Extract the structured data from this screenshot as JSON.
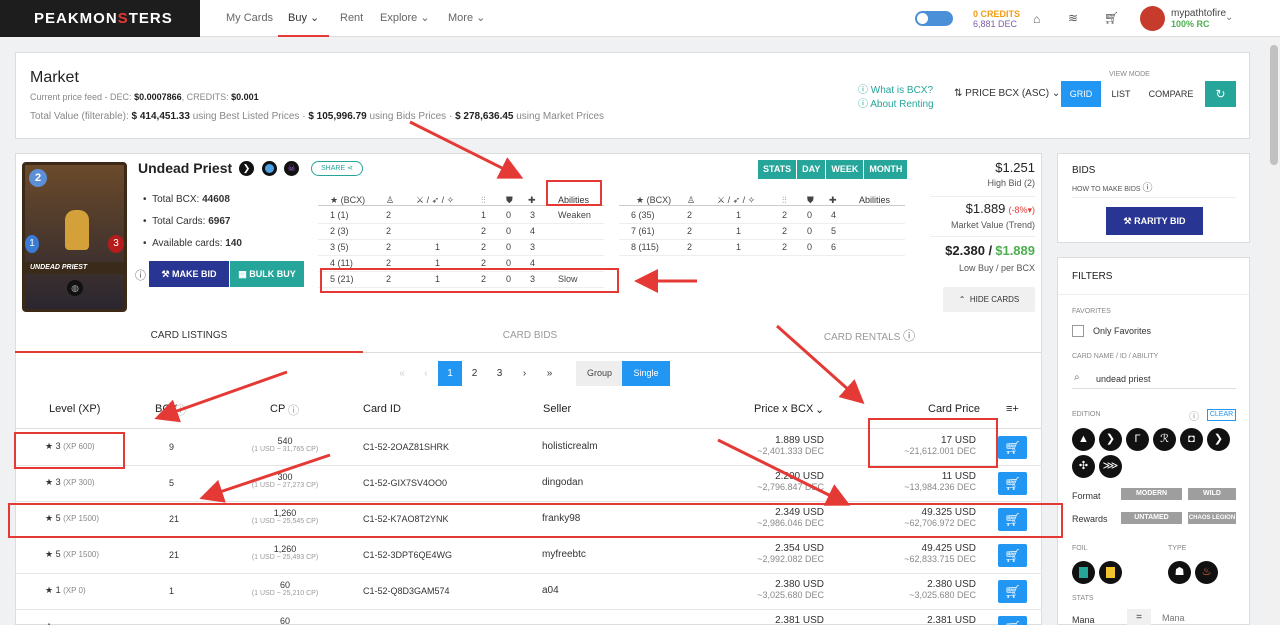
{
  "nav": {
    "logo_a": "PEAKMON",
    "logo_s": "S",
    "logo_b": "TERS",
    "links": [
      "My Cards",
      "Buy",
      "Rent",
      "Explore",
      "More"
    ],
    "credits": "0 CREDITS",
    "dec": "6,881 DEC",
    "username": "mypathtofire",
    "rc": "100% RC"
  },
  "market": {
    "title": "Market",
    "price_feed_label": "Current price feed - DEC:",
    "dec_price": "$0.0007866",
    "credits_label": ", CREDITS:",
    "credits_price": "$0.001",
    "total_label": "Total Value (filterable):",
    "best_value": "$ 414,451.33",
    "best_label": "using Best Listed Prices",
    "bids_value": "$ 105,996.79",
    "bids_label": "using Bids Prices",
    "market_value": "$ 278,636.45",
    "market_label": "using Market Prices",
    "what_bcx": "What is BCX?",
    "about_renting": "About Renting",
    "sort": "PRICE BCX (ASC)",
    "view_mode": "VIEW MODE",
    "view_buttons": [
      "GRID",
      "LIST",
      "COMPARE"
    ]
  },
  "card": {
    "name": "Undead Priest",
    "share": "SHARE",
    "image_label": "UNDEAD PRIEST",
    "mana": "2",
    "stat_left": "1",
    "stat_right": "3",
    "total_bcx_label": "Total BCX:",
    "total_bcx": "44608",
    "total_cards_label": "Total Cards:",
    "total_cards": "6967",
    "available_label": "Available cards:",
    "available": "140",
    "make_bid": "MAKE BID",
    "bulk_buy": "BULK BUY",
    "period_buttons": [
      "STATS",
      "DAY",
      "WEEK",
      "MONTH"
    ],
    "high_bid_price": "$1.251",
    "high_bid_label": "High Bid (2)",
    "market_value_price": "$1.889",
    "market_change": "(-8%",
    "market_value_label": "Market Value (Trend)",
    "low_buy": "$2.380 /",
    "per_bcx": "$1.889",
    "low_buy_label": "Low Buy / per BCX",
    "hide_cards": "HIDE CARDS"
  },
  "stats_table": {
    "headers": [
      "★ (BCX)",
      "♙",
      "⚔ / ➶ / ✧",
      "⫶⫶",
      "⛊",
      "✚",
      "Abilities"
    ],
    "left_rows": [
      [
        "1 (1)",
        "2",
        "",
        "1",
        "0",
        "3",
        "Weaken"
      ],
      [
        "2 (3)",
        "2",
        "",
        "2",
        "0",
        "4",
        ""
      ],
      [
        "3 (5)",
        "2",
        "1",
        "2",
        "0",
        "3",
        ""
      ],
      [
        "4 (11)",
        "2",
        "1",
        "2",
        "0",
        "4",
        ""
      ],
      [
        "5 (21)",
        "2",
        "1",
        "2",
        "0",
        "3",
        "Slow"
      ]
    ],
    "right_rows": [
      [
        "6 (35)",
        "2",
        "1",
        "2",
        "0",
        "4",
        ""
      ],
      [
        "7 (61)",
        "2",
        "1",
        "2",
        "0",
        "5",
        ""
      ],
      [
        "8 (115)",
        "2",
        "1",
        "2",
        "0",
        "6",
        ""
      ]
    ]
  },
  "tabs": [
    "CARD LISTINGS",
    "CARD BIDS",
    "CARD RENTALS"
  ],
  "pagination": {
    "pages": [
      "«",
      "‹",
      "1",
      "2",
      "3",
      "›",
      "»"
    ],
    "group": "Group",
    "single": "Single"
  },
  "listings": {
    "headers": [
      "Level (XP)",
      "BCX",
      "CP",
      "Card ID",
      "Seller",
      "Price x BCX",
      "Card Price"
    ],
    "rows": [
      {
        "level": "3",
        "xp": "(XP 600)",
        "bcx": "9",
        "cp": "540",
        "cp_sub": "(1 USD ~ 31,765 CP)",
        "id": "C1-52-2OAZ81SHRK",
        "seller": "holisticrealm",
        "price": "1.889 USD",
        "price_dec": "~2,401.333 DEC",
        "card_price": "17 USD",
        "card_dec": "~21,612.001 DEC"
      },
      {
        "level": "3",
        "xp": "(XP 300)",
        "bcx": "5",
        "cp": "300",
        "cp_sub": "(1 USD ~ 27,273 CP)",
        "id": "C1-52-GIX7SV4OO0",
        "seller": "dingodan",
        "price": "2.200 USD",
        "price_dec": "~2,796.847 DEC",
        "card_price": "11 USD",
        "card_dec": "~13,984.236 DEC"
      },
      {
        "level": "5",
        "xp": "(XP 1500)",
        "bcx": "21",
        "cp": "1,260",
        "cp_sub": "(1 USD ~ 25,545 CP)",
        "id": "C1-52-K7AO8T2YNK",
        "seller": "franky98",
        "price": "2.349 USD",
        "price_dec": "~2,986.046 DEC",
        "card_price": "49.325 USD",
        "card_dec": "~62,706.972 DEC"
      },
      {
        "level": "5",
        "xp": "(XP 1500)",
        "bcx": "21",
        "cp": "1,260",
        "cp_sub": "(1 USD ~ 25,493 CP)",
        "id": "C1-52-3DPT6QE4WG",
        "seller": "myfreebtc",
        "price": "2.354 USD",
        "price_dec": "~2,992.082 DEC",
        "card_price": "49.425 USD",
        "card_dec": "~62,833.715 DEC"
      },
      {
        "level": "1",
        "xp": "(XP 0)",
        "bcx": "1",
        "cp": "60",
        "cp_sub": "(1 USD ~ 25,210 CP)",
        "id": "C1-52-Q8D3GAM574",
        "seller": "a04",
        "price": "2.380 USD",
        "price_dec": "~3,025.680 DEC",
        "card_price": "2.380 USD",
        "card_dec": "~3,025.680 DEC"
      },
      {
        "level": "",
        "xp": "",
        "bcx": "",
        "cp": "60",
        "cp_sub": "",
        "id": "",
        "seller": "",
        "price": "2.381 USD",
        "price_dec": "",
        "card_price": "2.381 USD",
        "card_dec": ""
      }
    ]
  },
  "bids_panel": {
    "title": "BIDS",
    "how": "HOW TO MAKE BIDS",
    "rarity_bid": "RARITY BID"
  },
  "filters": {
    "title": "FILTERS",
    "favorites_label": "FAVORITES",
    "only_favorites": "Only Favorites",
    "search_label": "CARD NAME / ID / ABILITY",
    "search_value": "undead priest",
    "edition_label": "EDITION",
    "clear": "CLEAR",
    "format_label": "Format",
    "format_options": [
      "MODERN",
      "WILD"
    ],
    "rewards_label": "Rewards",
    "rewards_options": [
      "UNTAMED",
      "CHAOS LEGION"
    ],
    "foil_label": "FOIL",
    "type_label": "TYPE",
    "stats_label": "STATS",
    "mana_label": "Mana",
    "mana_op": "=",
    "mana_placeholder": "Mana"
  }
}
